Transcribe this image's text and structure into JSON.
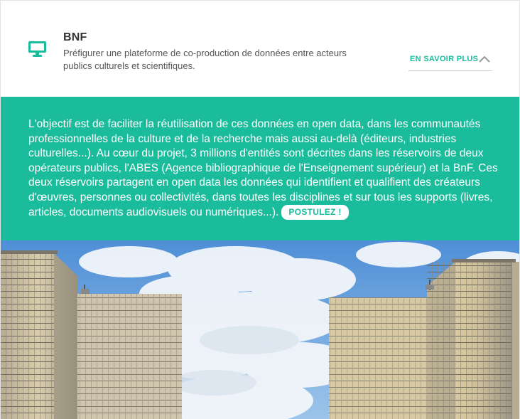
{
  "header": {
    "icon": "monitor-icon",
    "title": "BNF",
    "subtitle": "Préfigurer une plateforme de co-production de données entre acteurs publics culturels et scientifiques.",
    "more_label": "EN SAVOIR PLUS",
    "more_icon": "chevron-up-icon"
  },
  "panel": {
    "text": "L'objectif est de faciliter la réutilisation de ces données en open data, dans les communautés professionnelles de la culture et de la recherche mais aussi au-delà (éditeurs, industries culturelles...). Au cœur du projet, 3 millions d'entités sont décrites dans les réservoirs de deux opérateurs publics, l'ABES (Agence bibliographique de l'Enseignement supérieur) et la BnF. Ces deux réservoirs partagent en open data les données qui identifient et qualifient des créateurs d'œuvres, personnes ou collectivités, dans toutes les disciplines et sur tous les supports (livres, articles, documents audiovisuels ou numériques...).",
    "apply_label": "POSTULEZ !"
  },
  "colors": {
    "accent": "#1abc9c",
    "title": "#333333",
    "subtitle": "#555555"
  }
}
